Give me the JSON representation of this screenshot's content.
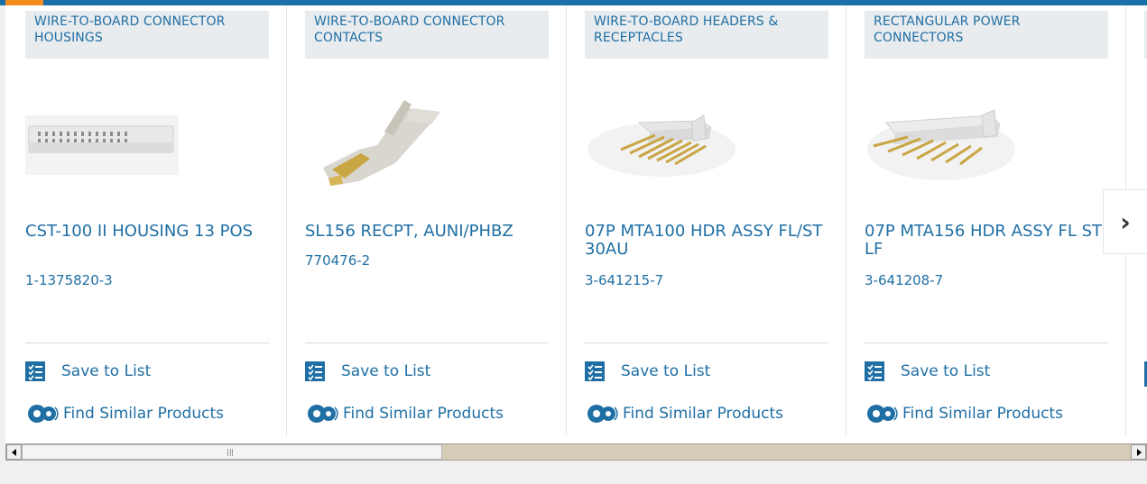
{
  "colors": {
    "link": "#1f6fa5",
    "accent": "#f28c1e",
    "bar": "#1a6fa6",
    "category_bg": "#e9ecee"
  },
  "cards": [
    {
      "category": "WIRE-TO-BOARD CONNECTOR HOUSINGS",
      "title": "CST-100 II HOUSING 13 POS",
      "part_number": "1-1375820-3",
      "save_label": "Save to List",
      "similar_label": "Find Similar Products",
      "image": "housing-image"
    },
    {
      "category": "WIRE-TO-BOARD CONNECTOR CONTACTS",
      "title": "SL156 RECPT, AUNI/PHBZ",
      "part_number": "770476-2",
      "save_label": "Save to List",
      "similar_label": "Find Similar Products",
      "image": "contact-image"
    },
    {
      "category": "WIRE-TO-BOARD HEADERS & RECEPTACLES",
      "title": "07P MTA100 HDR ASSY FL/ST 30AU",
      "part_number": "3-641215-7",
      "save_label": "Save to List",
      "similar_label": "Find Similar Products",
      "image": "header-image"
    },
    {
      "category": "RECTANGULAR POWER CONNECTORS",
      "title": "07P MTA156 HDR ASSY FL ST LF",
      "part_number": "3-641208-7",
      "save_label": "Save to List",
      "similar_label": "Find Similar Products",
      "image": "power-header-image"
    }
  ],
  "next_arrow": "›",
  "icons": {
    "save": "checklist-icon",
    "similar": "gears-icon",
    "next": "chevron-right-icon",
    "scroll_left": "triangle-left-icon",
    "scroll_right": "triangle-right-icon"
  }
}
